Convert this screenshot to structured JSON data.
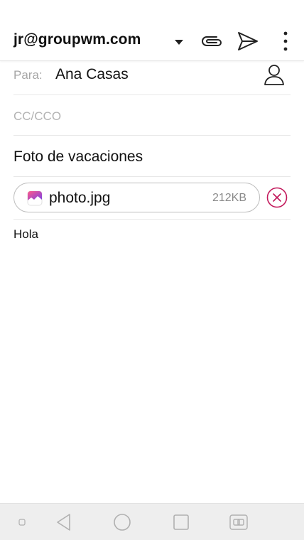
{
  "toolbar": {
    "from_account": "jr@groupwm.com",
    "icons": {
      "dropdown": "caret-down-icon",
      "attach": "paperclip-icon",
      "send": "send-icon",
      "more": "more-vert-icon"
    }
  },
  "compose": {
    "to_label": "Para:",
    "to_value": "Ana Casas",
    "cc_placeholder": "CC/CCO",
    "subject": "Foto de vacaciones",
    "attachment": {
      "name": "photo.jpg",
      "size": "212KB"
    },
    "body": "Hola"
  },
  "colors": {
    "accent": "#c2185b",
    "divider": "#e8e8e8",
    "label_gray": "#a6a6a6",
    "navbar_bg": "#eeeeee"
  }
}
